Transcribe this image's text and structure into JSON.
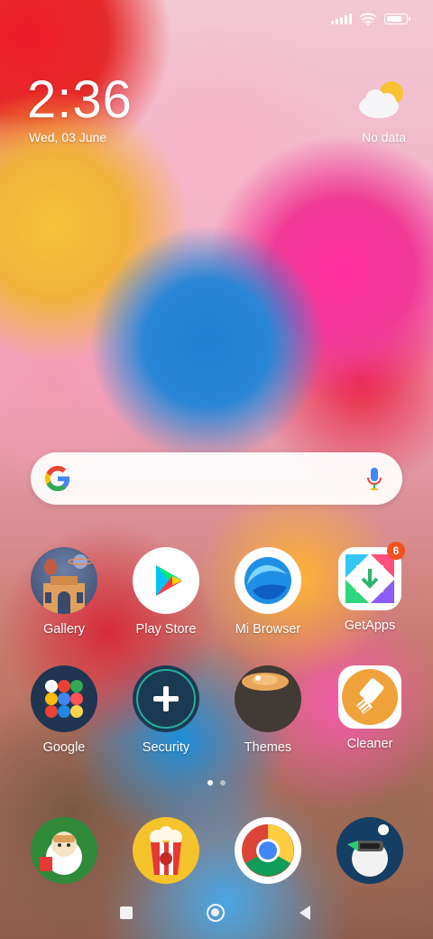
{
  "status_bar": {
    "icons": [
      "signal-icon",
      "wifi-icon",
      "battery-icon"
    ],
    "battery_level": 0.85
  },
  "clock_widget": {
    "time": "2:36",
    "date": "Wed, 03 June"
  },
  "weather_widget": {
    "icon": "partly-cloudy-icon",
    "text": "No data"
  },
  "search_bar": {
    "logo": "google-g-icon",
    "voice": "mic-icon"
  },
  "apps": [
    {
      "label": "Gallery"
    },
    {
      "label": "Play Store"
    },
    {
      "label": "Mi Browser"
    },
    {
      "label": "GetApps",
      "badge": "6"
    },
    {
      "label": "Google"
    },
    {
      "label": "Security"
    },
    {
      "label": "Themes"
    },
    {
      "label": "Cleaner"
    }
  ],
  "dock": [
    "mi-character-app-icon",
    "popcorn-app-icon",
    "chrome-icon",
    "mi-character-vr-app-icon"
  ],
  "page_indicator": {
    "pages": 2,
    "active": 1
  },
  "nav_bar": [
    "recents-button",
    "home-button",
    "back-button"
  ]
}
